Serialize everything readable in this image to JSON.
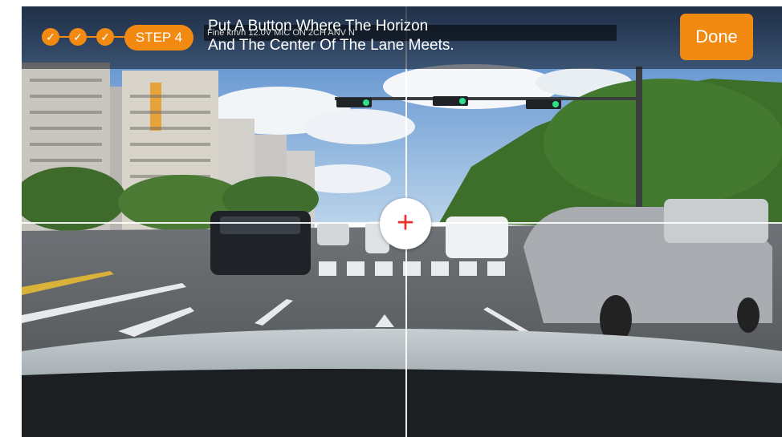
{
  "header": {
    "step_label": "STEP 4",
    "instruction_line1": "Put A Button Where The Horizon",
    "instruction_line2": "And The Center Of The Lane Meets.",
    "overlay_info": "Fine                                          km/h 12.0V MIC ON 2CH ANV N",
    "done_label": "Done",
    "completed_steps": 3
  },
  "checks": [
    "✓",
    "✓",
    "✓"
  ],
  "target": {
    "symbol": "+"
  },
  "colors": {
    "accent": "#f28a12",
    "target_plus": "#e8322c"
  },
  "icons": [
    "checkmark-icon",
    "plus-icon",
    "crosshair-lines"
  ]
}
